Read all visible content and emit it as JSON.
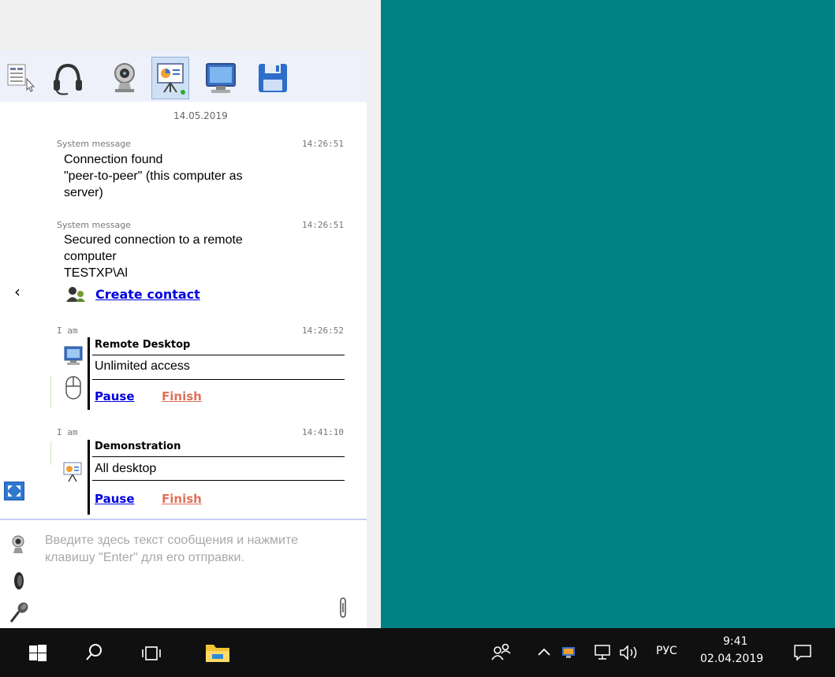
{
  "chat": {
    "date": "14.05.2019",
    "messages": [
      {
        "sender": "System message",
        "time": "14:26:51",
        "lines": [
          "Connection found",
          "\"peer-to-peer\" (this computer as",
          "server)"
        ]
      },
      {
        "sender": "System message",
        "time": "14:26:51",
        "lines": [
          "Secured connection to a remote",
          "computer",
          "TESTXP\\Al"
        ],
        "link": "Create contact"
      },
      {
        "sender": "I am",
        "time": "14:26:52",
        "card": {
          "title": "Remote Desktop",
          "value": "Unlimited access",
          "pause": "Pause",
          "finish": "Finish"
        }
      },
      {
        "sender": "I am",
        "time": "14:41:10",
        "card": {
          "title": "Demonstration",
          "value": "All desktop",
          "pause": "Pause",
          "finish": "Finish"
        }
      }
    ]
  },
  "compose": {
    "placeholder": "Введите здесь текст сообщения и нажмите клавишу \"Enter\" для его отправки."
  },
  "nav": {
    "back": "‹"
  },
  "taskbar": {
    "language": "РУС",
    "time": "9:41",
    "date": "02.04.2019"
  },
  "colors": {
    "desktop": "#008080",
    "link": "#0000e0",
    "finish": "#e0705a",
    "toolbar_bg": "#eef0fa"
  },
  "icons": [
    "contact-list-icon",
    "headset-icon",
    "webcam-icon",
    "presentation-icon",
    "monitor-icon",
    "floppy-save-icon",
    "fullscreen-icon",
    "camera-icon",
    "speaker-icon",
    "microphone-icon",
    "paperclip-icon",
    "windows-start-icon",
    "search-icon",
    "task-view-icon",
    "file-explorer-icon",
    "people-icon",
    "chevron-up-icon",
    "network-icon",
    "volume-icon",
    "notification-icon"
  ]
}
